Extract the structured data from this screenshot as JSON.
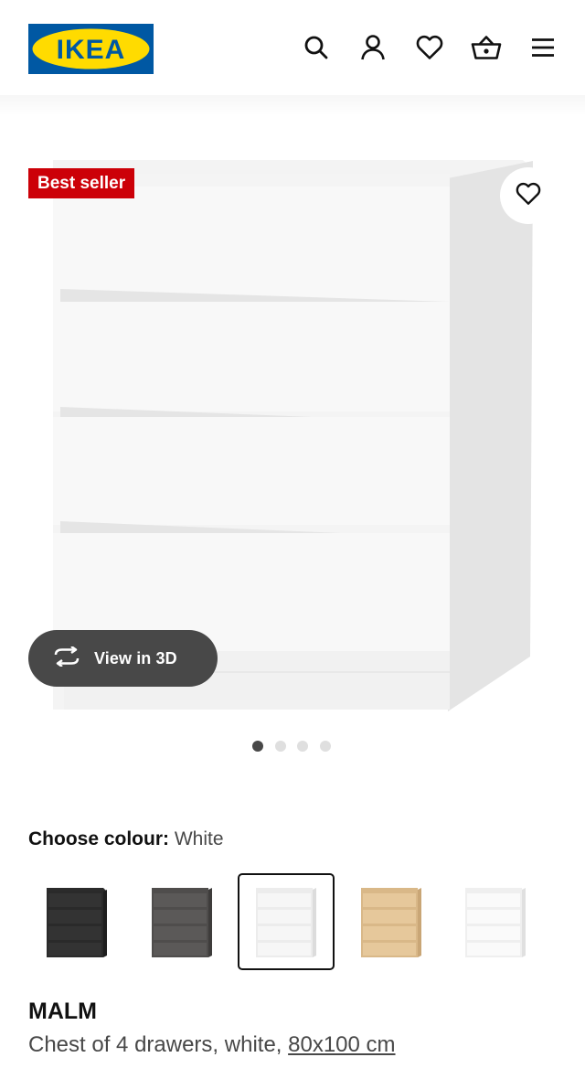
{
  "header": {
    "logo_text": "IKEA",
    "icons": [
      "search-icon",
      "user-icon",
      "heart-icon",
      "basket-icon",
      "menu-icon"
    ],
    "brand_colors": {
      "blue": "#0058a3",
      "yellow": "#ffdb00"
    }
  },
  "product_image": {
    "badge": "Best seller",
    "badge_color": "#cc0008",
    "view3d_label": "View in 3D",
    "carousel": {
      "count": 4,
      "active_index": 0
    }
  },
  "colour_chooser": {
    "label": "Choose colour:",
    "selected_value": "White",
    "options": [
      {
        "colour": "black-brown",
        "hex": "#2d2d2d",
        "selected": false
      },
      {
        "colour": "dark-grey",
        "hex": "#555352",
        "selected": false
      },
      {
        "colour": "white",
        "hex": "#f2f2f2",
        "selected": true
      },
      {
        "colour": "oak-veneer",
        "hex": "#e2c394",
        "selected": false
      },
      {
        "colour": "high-gloss-white",
        "hex": "#f6f6f6",
        "selected": false
      }
    ]
  },
  "product": {
    "name": "MALM",
    "description": "Chest of 4 drawers, white,",
    "size_link": "80x100 cm"
  }
}
